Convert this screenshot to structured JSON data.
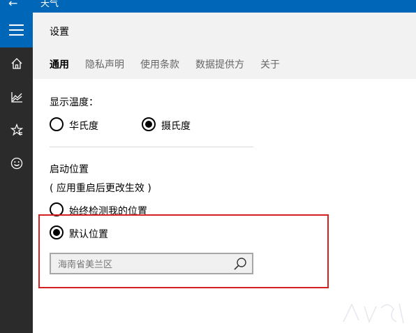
{
  "titlebar": {
    "back_glyph": "←",
    "app_title": "天气",
    "accent": "#0067b8"
  },
  "nav": {
    "items": [
      {
        "icon": "home-icon"
      },
      {
        "icon": "chart-icon"
      },
      {
        "icon": "favorites-icon"
      },
      {
        "icon": "smiley-icon"
      }
    ]
  },
  "header": {
    "title": "设置",
    "tabs": [
      {
        "label": "通用",
        "active": true
      },
      {
        "label": "隐私声明"
      },
      {
        "label": "使用条款"
      },
      {
        "label": "数据提供方"
      },
      {
        "label": "关于"
      }
    ]
  },
  "temperature": {
    "heading": "显示温度：",
    "options": [
      {
        "label": "华氏度",
        "checked": false
      },
      {
        "label": "摄氏度",
        "checked": true
      }
    ]
  },
  "location": {
    "heading": "启动位置",
    "note": "( 应用重启后更改生效 )",
    "options": [
      {
        "label": "始终检测我的位置",
        "checked": false
      },
      {
        "label": "默认位置",
        "checked": true
      }
    ],
    "search_value": "海南省美兰区"
  },
  "colors": {
    "highlight": "#d42020"
  }
}
